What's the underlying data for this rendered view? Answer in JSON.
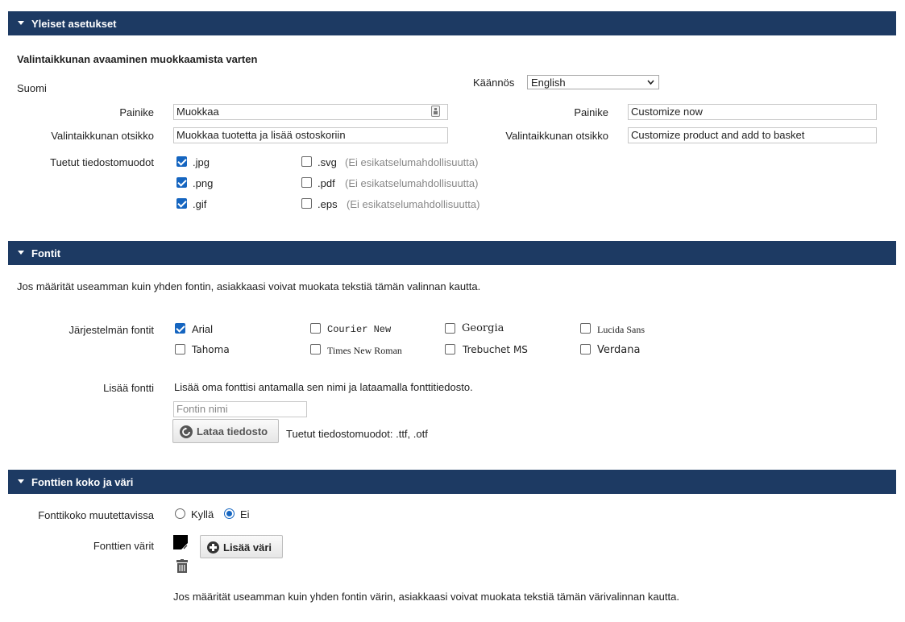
{
  "sections": {
    "general": {
      "title": "Yleiset asetukset",
      "subtitle": "Valintaikkunan avaaminen muokkaamista varten",
      "language_label": "Suomi",
      "translation_label": "Käännös",
      "translation_value": "English",
      "button_label": "Painike",
      "button_value_fi": "Muokkaa",
      "button_value_en": "Customize now",
      "dialog_title_label": "Valintaikkunan otsikko",
      "dialog_title_fi": "Muokkaa tuotetta ja lisää ostoskoriin",
      "dialog_title_en": "Customize product and add to basket",
      "formats_label": "Tuetut tiedostomuodot",
      "formats": [
        {
          "label": ".jpg",
          "checked": true,
          "note": ""
        },
        {
          "label": ".png",
          "checked": true,
          "note": ""
        },
        {
          "label": ".gif",
          "checked": true,
          "note": ""
        },
        {
          "label": ".svg",
          "checked": false,
          "note": "(Ei esikatselumahdollisuutta)"
        },
        {
          "label": ".pdf",
          "checked": false,
          "note": "(Ei esikatselumahdollisuutta)"
        },
        {
          "label": ".eps",
          "checked": false,
          "note": "(Ei esikatselumahdollisuutta)"
        }
      ]
    },
    "fonts": {
      "title": "Fontit",
      "intro": "Jos määrität useamman kuin yhden fontin, asiakkaasi voivat muokata tekstiä tämän valinnan kautta.",
      "system_fonts_label": "Järjestelmän fontit",
      "system_fonts": [
        {
          "label": "Arial",
          "checked": true
        },
        {
          "label": "Courier New",
          "checked": false
        },
        {
          "label": "Georgia",
          "checked": false
        },
        {
          "label": "Lucida Sans",
          "checked": false
        },
        {
          "label": "Tahoma",
          "checked": false
        },
        {
          "label": "Times New Roman",
          "checked": false
        },
        {
          "label": "Trebuchet MS",
          "checked": false
        },
        {
          "label": "Verdana",
          "checked": false
        }
      ],
      "add_font_label": "Lisää fontti",
      "add_font_help": "Lisää oma fonttisi antamalla sen nimi ja lataamalla fonttitiedosto.",
      "font_name_placeholder": "Fontin nimi",
      "upload_button": "Lataa tiedosto",
      "upload_formats": "Tuetut tiedostomuodot: .ttf, .otf"
    },
    "size_color": {
      "title": "Fonttien koko ja väri",
      "size_changeable_label": "Fonttikoko muutettavissa",
      "size_yes": "Kyllä",
      "size_no": "Ei",
      "size_selected": "Ei",
      "colors_label": "Fonttien värit",
      "swatch_color": "#000000",
      "add_color_button": "Lisää väri",
      "note": "Jos määrität useamman kuin yhden fontin värin, asiakkaasi voivat muokata tekstiä tämän värivalinnan kautta."
    }
  },
  "colors": {
    "header_bg": "#1d3a63",
    "checkbox_accent": "#1565c0"
  }
}
